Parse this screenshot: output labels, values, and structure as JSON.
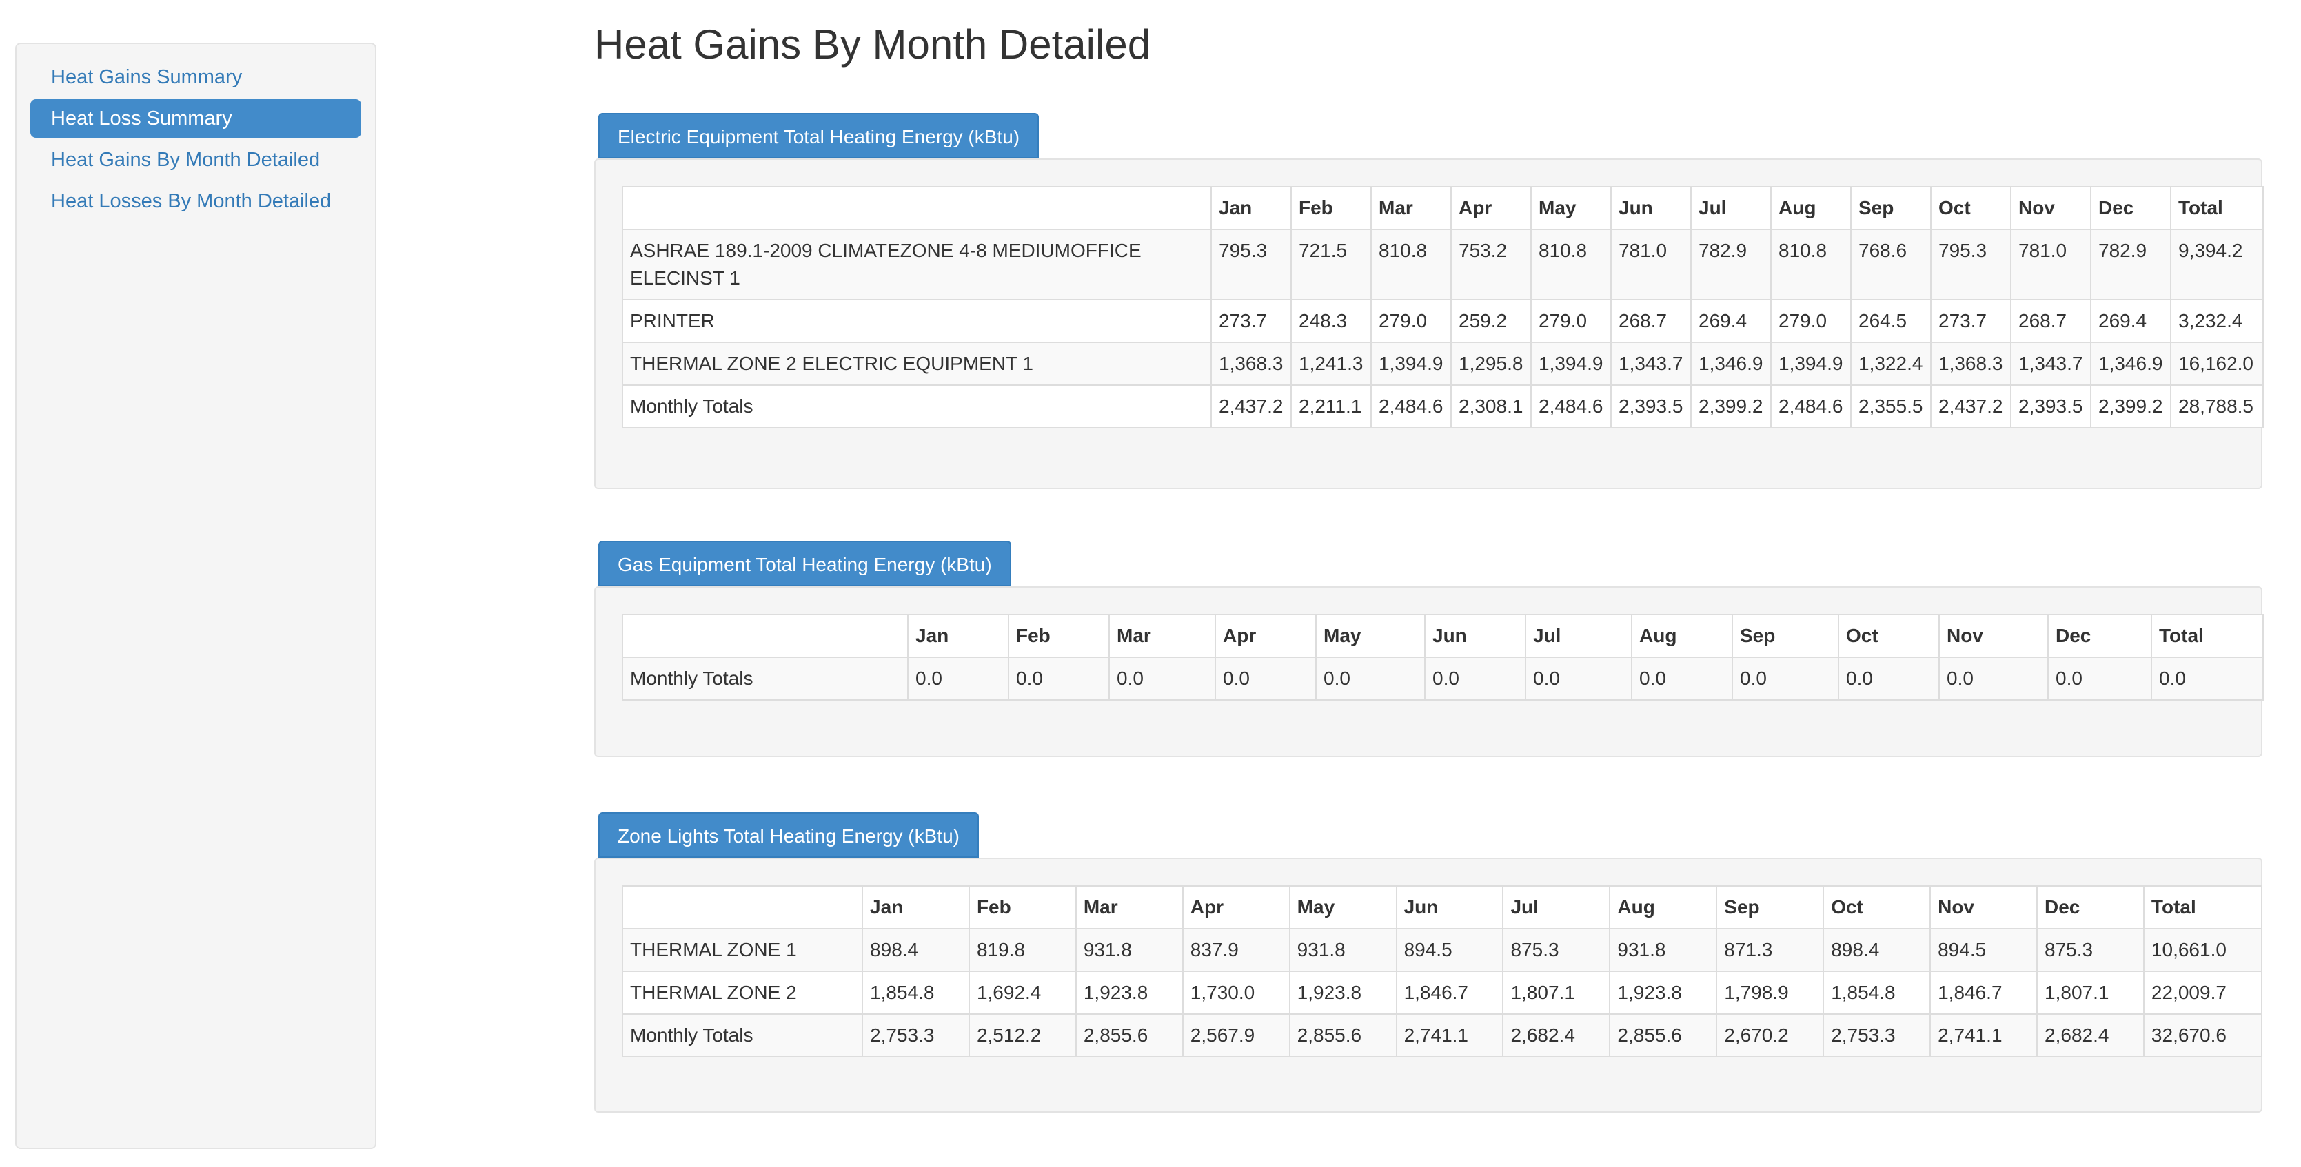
{
  "sidebar": {
    "items": [
      {
        "label": "Heat Gains Summary",
        "active": false
      },
      {
        "label": "Heat Loss Summary",
        "active": true
      },
      {
        "label": "Heat Gains By Month Detailed",
        "active": false
      },
      {
        "label": "Heat Losses By Month Detailed",
        "active": false
      }
    ]
  },
  "page": {
    "title": "Heat Gains By Month Detailed"
  },
  "columns": [
    "",
    "Jan",
    "Feb",
    "Mar",
    "Apr",
    "May",
    "Jun",
    "Jul",
    "Aug",
    "Sep",
    "Oct",
    "Nov",
    "Dec",
    "Total"
  ],
  "sections": [
    {
      "tab": "Electric Equipment Total Heating Energy (kBtu)",
      "rows": [
        [
          "ASHRAE 189.1-2009 CLIMATEZONE 4-8 MEDIUMOFFICE ELECINST 1",
          "795.3",
          "721.5",
          "810.8",
          "753.2",
          "810.8",
          "781.0",
          "782.9",
          "810.8",
          "768.6",
          "795.3",
          "781.0",
          "782.9",
          "9,394.2"
        ],
        [
          "PRINTER",
          "273.7",
          "248.3",
          "279.0",
          "259.2",
          "279.0",
          "268.7",
          "269.4",
          "279.0",
          "264.5",
          "273.7",
          "268.7",
          "269.4",
          "3,232.4"
        ],
        [
          "THERMAL ZONE 2 ELECTRIC EQUIPMENT 1",
          "1,368.3",
          "1,241.3",
          "1,394.9",
          "1,295.8",
          "1,394.9",
          "1,343.7",
          "1,346.9",
          "1,394.9",
          "1,322.4",
          "1,368.3",
          "1,343.7",
          "1,346.9",
          "16,162.0"
        ],
        [
          "Monthly Totals",
          "2,437.2",
          "2,211.1",
          "2,484.6",
          "2,308.1",
          "2,484.6",
          "2,393.5",
          "2,399.2",
          "2,484.6",
          "2,355.5",
          "2,437.2",
          "2,393.5",
          "2,399.2",
          "28,788.5"
        ]
      ]
    },
    {
      "tab": "Gas Equipment Total Heating Energy (kBtu)",
      "rows": [
        [
          "Monthly Totals",
          "0.0",
          "0.0",
          "0.0",
          "0.0",
          "0.0",
          "0.0",
          "0.0",
          "0.0",
          "0.0",
          "0.0",
          "0.0",
          "0.0",
          "0.0"
        ]
      ]
    },
    {
      "tab": "Zone Lights Total Heating Energy (kBtu)",
      "rows": [
        [
          "THERMAL ZONE 1",
          "898.4",
          "819.8",
          "931.8",
          "837.9",
          "931.8",
          "894.5",
          "875.3",
          "931.8",
          "871.3",
          "898.4",
          "894.5",
          "875.3",
          "10,661.0"
        ],
        [
          "THERMAL ZONE 2",
          "1,854.8",
          "1,692.4",
          "1,923.8",
          "1,730.0",
          "1,923.8",
          "1,846.7",
          "1,807.1",
          "1,923.8",
          "1,798.9",
          "1,854.8",
          "1,846.7",
          "1,807.1",
          "22,009.7"
        ],
        [
          "Monthly Totals",
          "2,753.3",
          "2,512.2",
          "2,855.6",
          "2,567.9",
          "2,855.6",
          "2,741.1",
          "2,682.4",
          "2,855.6",
          "2,670.2",
          "2,753.3",
          "2,741.1",
          "2,682.4",
          "32,670.6"
        ]
      ]
    }
  ]
}
